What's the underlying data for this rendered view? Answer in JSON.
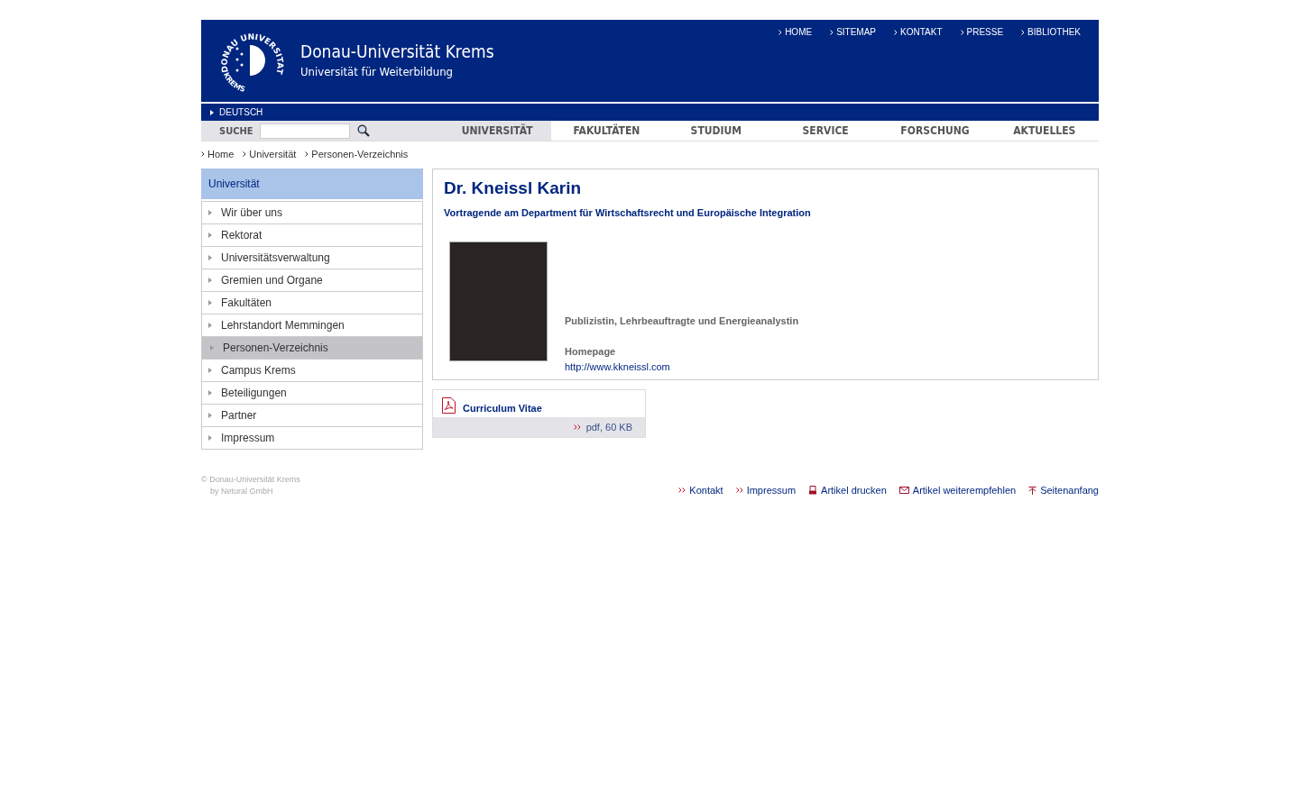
{
  "header": {
    "logo": {
      "ring_text": "DONAU UNIVERSITÄT",
      "bottom_text": "KREMS"
    },
    "title": "Donau-Universität Krems",
    "subtitle": "Universität für Weiterbildung",
    "top_links": [
      "HOME",
      "SITEMAP",
      "KONTAKT",
      "PRESSE",
      "BIBLIOTHEK"
    ],
    "language": "DEUTSCH"
  },
  "search": {
    "label": "SUCHE"
  },
  "nav": [
    {
      "label": "UNIVERSITÄT",
      "selected": true
    },
    {
      "label": "FAKULTÄTEN",
      "selected": false
    },
    {
      "label": "STUDIUM",
      "selected": false
    },
    {
      "label": "SERVICE",
      "selected": false
    },
    {
      "label": "FORSCHUNG",
      "selected": false
    },
    {
      "label": "AKTUELLES",
      "selected": false
    }
  ],
  "breadcrumb": [
    "Home",
    "Universität",
    "Personen-Verzeichnis"
  ],
  "sidebar": {
    "title": "Universität",
    "items": [
      {
        "label": "Wir über uns",
        "selected": false
      },
      {
        "label": "Rektorat",
        "selected": false
      },
      {
        "label": "Universitätsverwaltung",
        "selected": false
      },
      {
        "label": "Gremien und Organe",
        "selected": false
      },
      {
        "label": "Fakultäten",
        "selected": false
      },
      {
        "label": "Lehrstandort Memmingen",
        "selected": false
      },
      {
        "label": "Personen-Verzeichnis",
        "selected": true
      },
      {
        "label": "Campus Krems",
        "selected": false
      },
      {
        "label": "Beteiligungen",
        "selected": false
      },
      {
        "label": "Partner",
        "selected": false
      },
      {
        "label": "Impressum",
        "selected": false
      }
    ]
  },
  "profile": {
    "name": "Dr. Kneissl Karin",
    "role": "Vortragende am Department für Wirtschaftsrecht und Europäische Integration",
    "description": "Publizistin, Lehrbeauftragte und Energieanalystin",
    "homepage_label": "Homepage",
    "homepage_url": "http://www.kkneissl.com"
  },
  "download": {
    "title": "Curriculum Vitae",
    "info": "pdf, 60 KB"
  },
  "footer": {
    "copyright": "© Donau-Universität Krems",
    "credit": "by Netural GmbH",
    "links": [
      {
        "label": "Kontakt",
        "kind": "arrow"
      },
      {
        "label": "Impressum",
        "kind": "arrow"
      },
      {
        "label": "Artikel drucken",
        "kind": "print"
      },
      {
        "label": "Artikel weiterempfehlen",
        "kind": "mail"
      },
      {
        "label": "Seitenanfang",
        "kind": "top"
      }
    ]
  }
}
